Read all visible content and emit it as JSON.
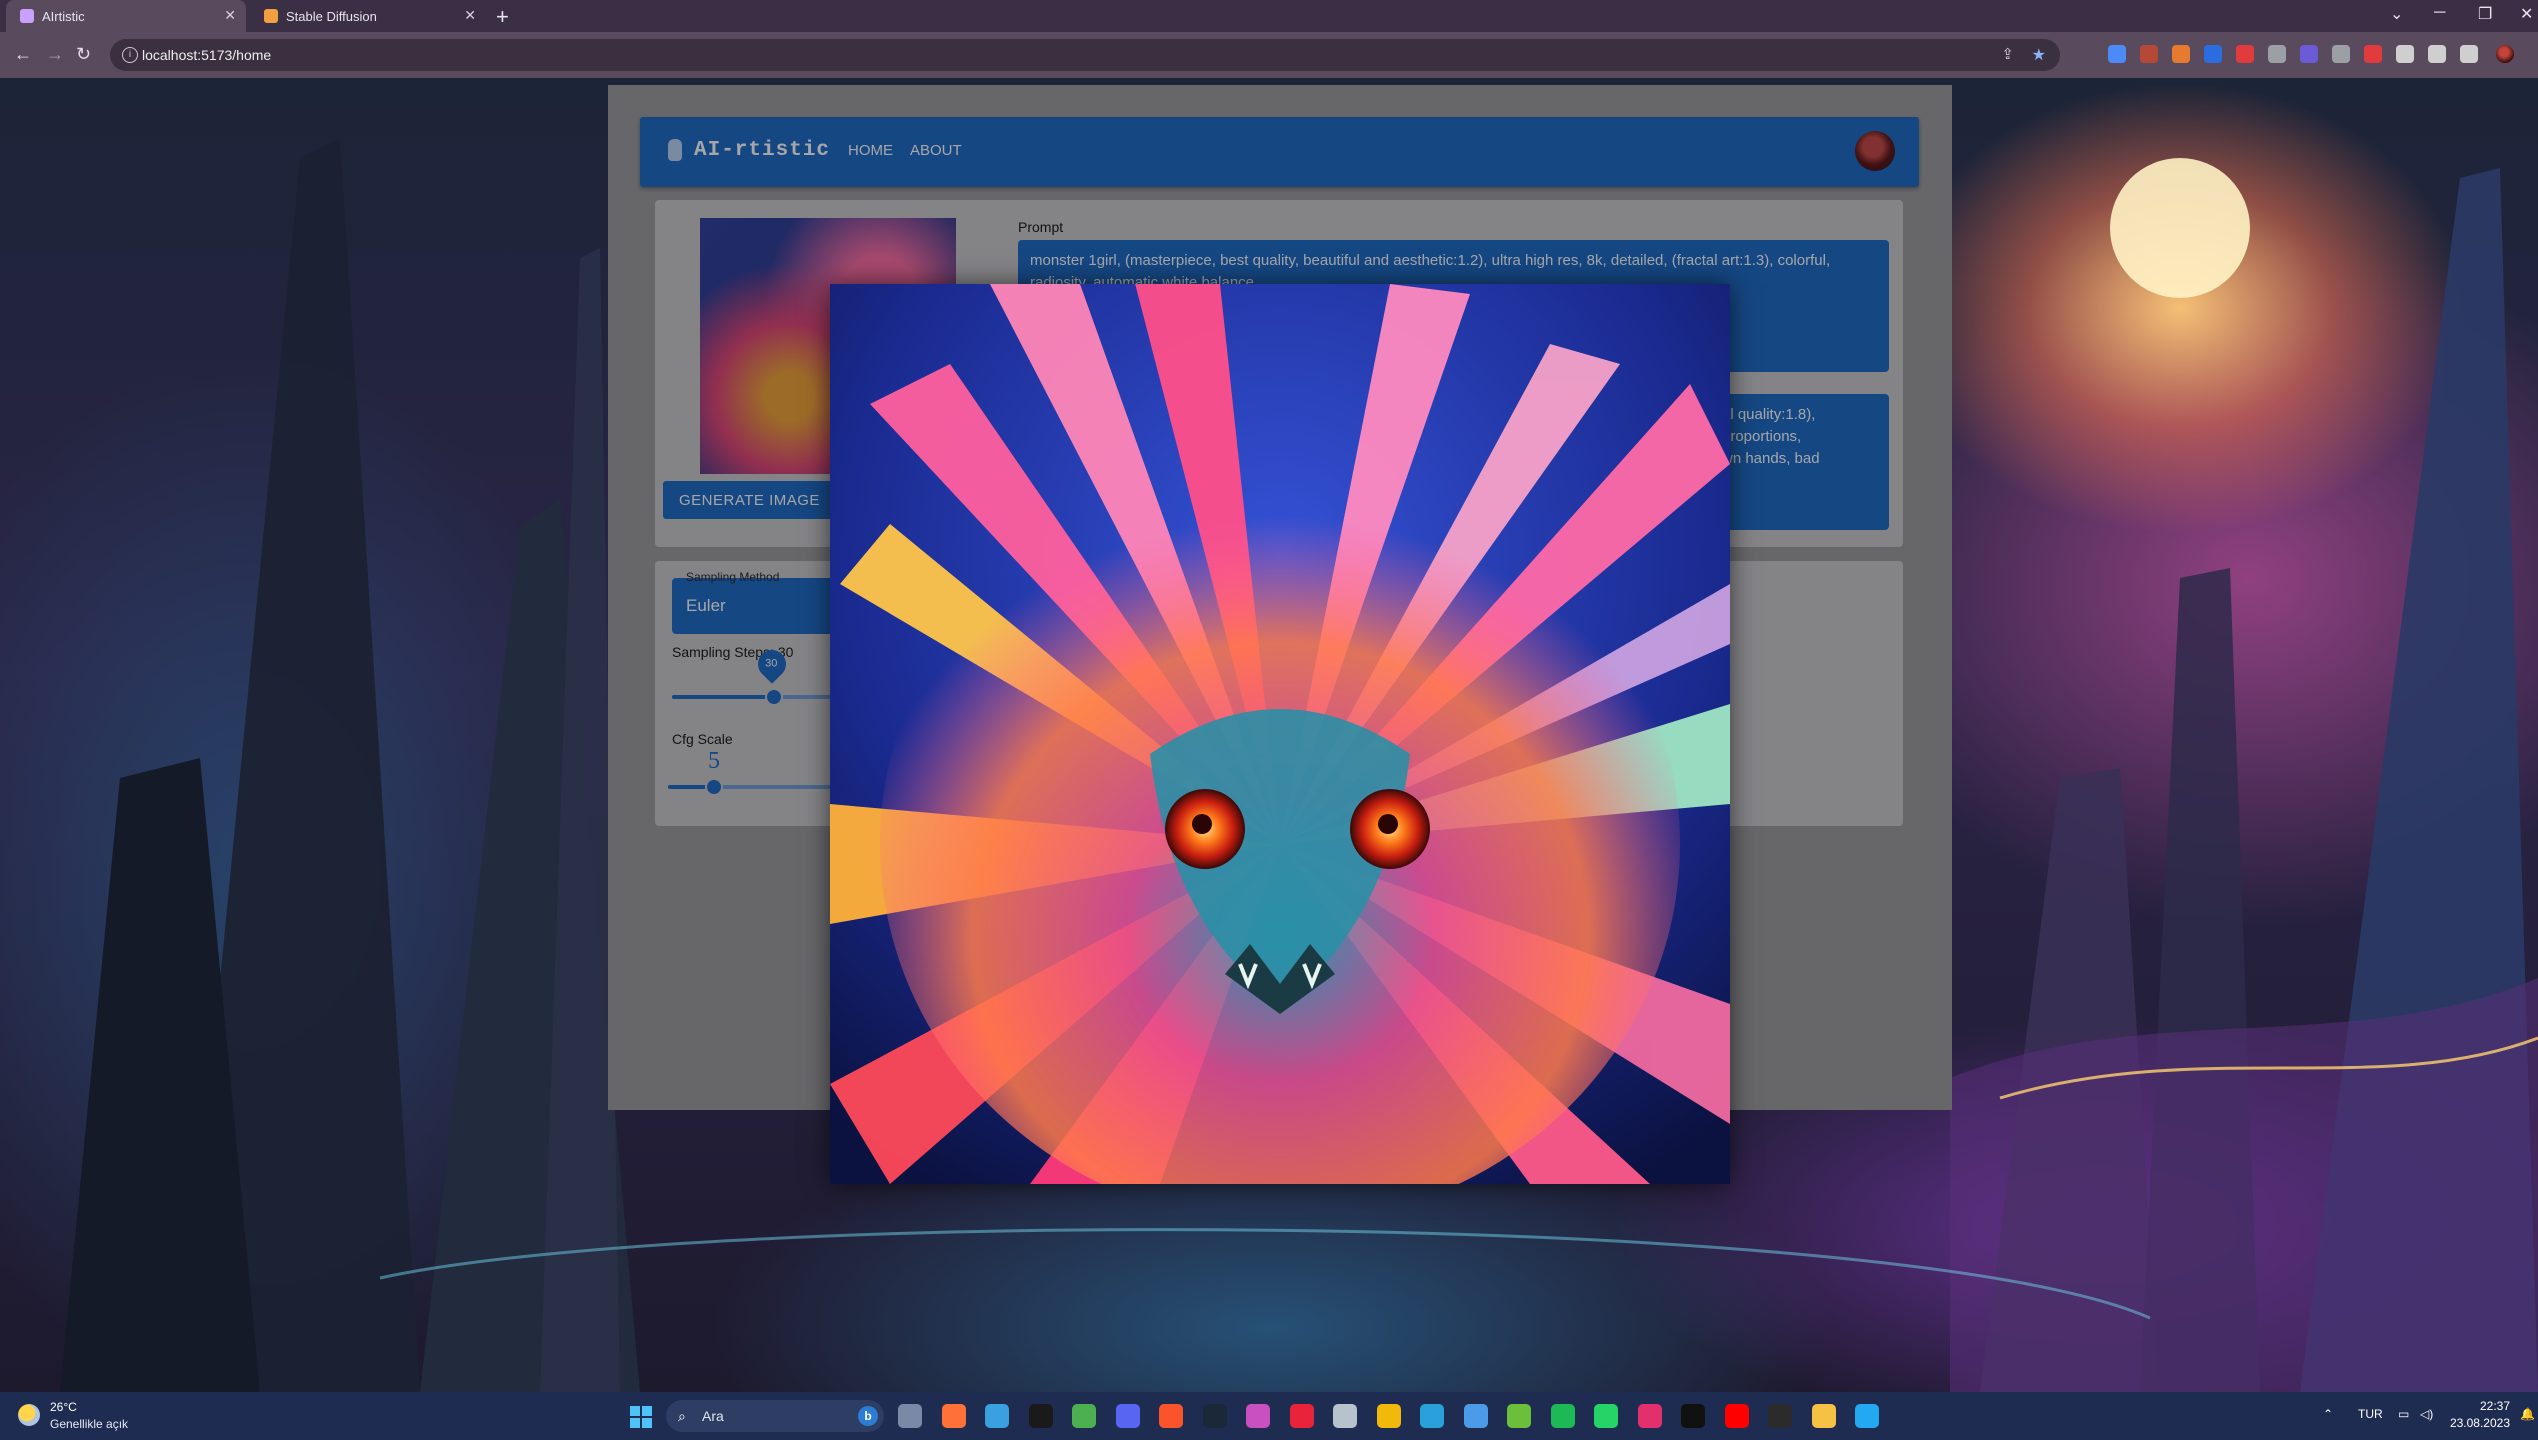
{
  "browser": {
    "tabs": [
      {
        "title": "AIrtistic",
        "active": true,
        "favicon_color": "#c9a2ff"
      },
      {
        "title": "Stable Diffusion",
        "active": false,
        "favicon_color": "#f0a040"
      }
    ],
    "url": "localhost:5173/home",
    "extension_colors": [
      "#4c8bf5",
      "#b44a36",
      "#e67a2e",
      "#2b6de0",
      "#e23b3b",
      "#9aa0a6",
      "#6b5bd6",
      "#9aa0a6",
      "#e23b3b",
      "#cfcfcf",
      "#cfcfcf",
      "#cfcfcf"
    ]
  },
  "app": {
    "brand": "AI-rtistic",
    "nav": [
      {
        "label": "HOME"
      },
      {
        "label": "ABOUT"
      }
    ],
    "generate_button": "GENERATE IMAGE",
    "prompt_label": "Prompt",
    "prompt_text": "monster 1girl, (masterpiece, best quality, beautiful and aesthetic:1.2), ultra high res, 8k, detailed, (fractal art:1.3), colorful, radiosity, automatic white balance",
    "negative_lines": [
      "al quality:1.8),",
      "proportions,",
      "wn hands, bad"
    ],
    "sampling_method_label": "Sampling Method",
    "sampling_method_value": "Euler",
    "sampling_steps_label": "Sampling Steps: 30",
    "sampling_steps_value": 30,
    "sampling_steps_bubble": "30",
    "cfg_label": "Cfg Scale",
    "cfg_value": "5",
    "colors": {
      "primary": "#1667c2",
      "card": "#c8c8c8"
    }
  },
  "taskbar": {
    "temperature": "26°C",
    "weather": "Genellikle açık",
    "search_placeholder": "Ara",
    "bing_label": "b",
    "language": "TUR",
    "time": "22:37",
    "date": "23.08.2023",
    "app_icons": [
      {
        "name": "file-explorer-view",
        "color": "#7a8aa6"
      },
      {
        "name": "firefox",
        "color": "#ff7139"
      },
      {
        "name": "remote-desktop",
        "color": "#3aa0e0"
      },
      {
        "name": "opera",
        "color": "#1a1a1a"
      },
      {
        "name": "chrome",
        "color": "#4caf50"
      },
      {
        "name": "discord",
        "color": "#5865f2"
      },
      {
        "name": "brave",
        "color": "#fb542b"
      },
      {
        "name": "steam",
        "color": "#1b2838"
      },
      {
        "name": "droplet",
        "color": "#c850c0"
      },
      {
        "name": "opera-gx",
        "color": "#e8233a"
      },
      {
        "name": "shield",
        "color": "#b8c2cc"
      },
      {
        "name": "binance",
        "color": "#f0b90b"
      },
      {
        "name": "telegram",
        "color": "#2aa1da"
      },
      {
        "name": "mail",
        "color": "#4c9be8"
      },
      {
        "name": "xbox",
        "color": "#6cbf3a"
      },
      {
        "name": "spotify",
        "color": "#1db954"
      },
      {
        "name": "whatsapp",
        "color": "#25d366"
      },
      {
        "name": "instagram",
        "color": "#e1306c"
      },
      {
        "name": "tiktok",
        "color": "#111111"
      },
      {
        "name": "youtube",
        "color": "#ff0000"
      },
      {
        "name": "terminal",
        "color": "#2b2b2b"
      },
      {
        "name": "folder",
        "color": "#f6c244"
      },
      {
        "name": "vscode",
        "color": "#23a9f2"
      }
    ]
  }
}
